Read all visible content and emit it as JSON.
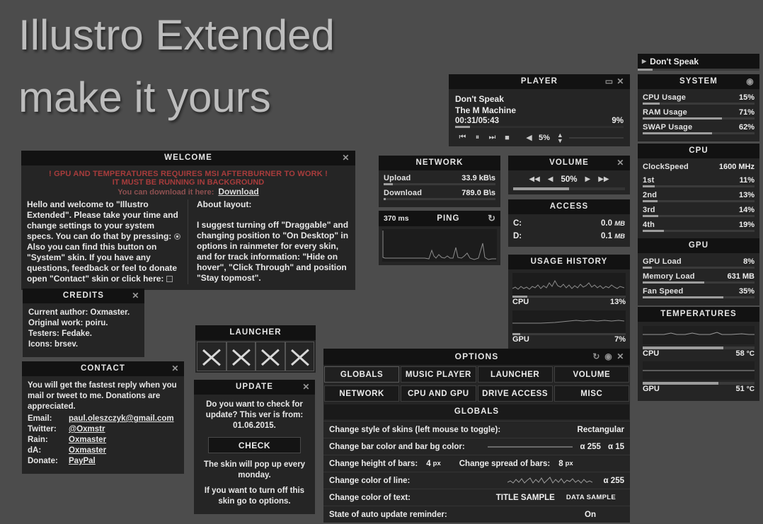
{
  "wallpaper": {
    "title": "Illustro Extended\nmake it yours"
  },
  "welcome": {
    "title": "WELCOME",
    "close": "✕",
    "warning_line1": "! GPU AND TEMPERATURES REQUIRES MSI AFTERBURNER TO WORK !",
    "warning_line2": "IT MUST BE RUNNING IN BACKGROUND",
    "download_prompt": "You can download it here:",
    "download_link": "Download",
    "left_text_1": "Hello and welcome to \"Illustro Extended\". Please take your time and change settings to your system specs. You can do that by pressing:",
    "left_text_2": "Also you can find this button on \"System\" skin. If you have any questions, feedback or feel to donate open \"Contact\" skin or click here:",
    "right_heading": "About layout:",
    "right_text": "I suggest turning off \"Draggable\" and changing position to \"On Desktop\" in options in rainmeter for every skin, and for track information: \"Hide on hover\", \"Click Through\" and position \"Stay topmost\"."
  },
  "credits": {
    "title": "CREDITS",
    "close": "✕",
    "lines": [
      "Current author: Oxmaster.",
      "Original work: poiru.",
      "Testers: Fedake.",
      "Icons: brsev."
    ]
  },
  "contact": {
    "title": "CONTACT",
    "close": "✕",
    "intro": "You will get the fastest reply when you mail or tweet to me. Donations are appreciated.",
    "rows": [
      {
        "label": "Email:",
        "value": "paul.oleszczyk@gmail.com"
      },
      {
        "label": "Twitter:",
        "value": "@Oxmstr"
      },
      {
        "label": "Rain:",
        "value": "Oxmaster"
      },
      {
        "label": "dA:",
        "value": "Oxmaster"
      },
      {
        "label": "Donate:",
        "value": "PayPal"
      }
    ]
  },
  "launcher": {
    "title": "LAUNCHER",
    "slots": [
      "x-icon",
      "x-icon",
      "x-icon",
      "x-icon"
    ]
  },
  "update": {
    "title": "UPDATE",
    "close": "✕",
    "prompt": "Do you want to check for update? This ver is from: 01.06.2015.",
    "check_label": "CHECK",
    "note1": "The skin will pop up every monday.",
    "note2": "If you want to turn off this skin go to options."
  },
  "player": {
    "title": "PLAYER",
    "maximize": "▭",
    "close": "✕",
    "track": "Don't Speak",
    "artist": "The M Machine",
    "time": "00:31/05:43",
    "progress_pct": "9%",
    "progress_value": 9,
    "controls": [
      "prev-icon",
      "pause-icon",
      "next-icon",
      "stop-icon"
    ],
    "volume_icon": "speaker-icon",
    "volume_pct": "5%",
    "volume_value": 5
  },
  "network": {
    "title": "NETWORK",
    "rows": [
      {
        "label": "Upload",
        "value": "33.9 kB\\s",
        "bar": 8
      },
      {
        "label": "Download",
        "value": "789.0 B\\s",
        "bar": 2
      }
    ]
  },
  "ping": {
    "ms": "370 ms",
    "title": "PING",
    "refresh": "refresh-icon"
  },
  "volume": {
    "title": "VOLUME",
    "close": "✕",
    "prev_track": "◀◀",
    "down": "◀",
    "level": "50%",
    "level_value": 50,
    "up": "▶",
    "next_track": "▶▶"
  },
  "access": {
    "title": "ACCESS",
    "rows": [
      {
        "label": "C:",
        "value": "0.0",
        "unit": "MB"
      },
      {
        "label": "D:",
        "value": "0.1",
        "unit": "MB"
      }
    ]
  },
  "usage_history": {
    "title": "USAGE HISTORY",
    "rows": [
      {
        "label": "CPU",
        "value": "13%",
        "bar": 13
      },
      {
        "label": "GPU",
        "value": "7%",
        "bar": 7
      }
    ]
  },
  "nowplaying": {
    "arrow": "play-arrow-icon",
    "text": "Don't Speak",
    "bar": 12
  },
  "system": {
    "title": "SYSTEM",
    "settings_icon": "gear-icon",
    "rows": [
      {
        "label": "CPU Usage",
        "value": "15%",
        "bar": 15
      },
      {
        "label": "RAM Usage",
        "value": "71%",
        "bar": 71
      },
      {
        "label": "SWAP Usage",
        "value": "62%",
        "bar": 62
      }
    ]
  },
  "cpu": {
    "title": "CPU",
    "clock_label": "ClockSpeed",
    "clock_value": "1600 MHz",
    "cores": [
      {
        "label": "1st",
        "value": "11%",
        "bar": 11
      },
      {
        "label": "2nd",
        "value": "13%",
        "bar": 13
      },
      {
        "label": "3rd",
        "value": "14%",
        "bar": 14
      },
      {
        "label": "4th",
        "value": "19%",
        "bar": 19
      }
    ]
  },
  "gpu": {
    "title": "GPU",
    "rows": [
      {
        "label": "GPU Load",
        "value": "8%",
        "bar": 8
      },
      {
        "label": "Memory Load",
        "value": "631 MB",
        "bar": 55
      },
      {
        "label": "Fan Speed",
        "value": "35%",
        "bar": 72
      }
    ]
  },
  "temperatures": {
    "title": "TEMPERATURES",
    "rows": [
      {
        "label": "CPU",
        "value": "58",
        "unit": "°C",
        "bar": 72
      },
      {
        "label": "GPU",
        "value": "51",
        "unit": "°C",
        "bar": 68
      }
    ]
  },
  "options": {
    "title": "OPTIONS",
    "refresh_icon": "refresh-icon",
    "settings_icon": "gear-icon",
    "close": "✕",
    "tabs": [
      {
        "label": "GLOBALS",
        "active": true
      },
      {
        "label": "MUSIC PLAYER",
        "active": false
      },
      {
        "label": "LAUNCHER",
        "active": false
      },
      {
        "label": "VOLUME",
        "active": false
      },
      {
        "label": "NETWORK",
        "active": false
      },
      {
        "label": "CPU AND GPU",
        "active": false
      },
      {
        "label": "DRIVE ACCESS",
        "active": false
      },
      {
        "label": "MISC",
        "active": false
      }
    ],
    "section_title": "GLOBALS",
    "rows": {
      "style": {
        "label": "Change style of skins (left mouse to toggle):",
        "value": "Rectangular"
      },
      "bar_color": {
        "label": "Change bar color and bar bg color:",
        "alpha1": "α 255",
        "alpha2": "α  15"
      },
      "bar_height": {
        "label": "Change height of bars:",
        "value": "4",
        "unit": "px"
      },
      "bar_spread": {
        "label": "Change spread of bars:",
        "value": "8",
        "unit": "px"
      },
      "line_color": {
        "label": "Change color of line:",
        "alpha": "α 255"
      },
      "text_color": {
        "label": "Change color of text:",
        "title_sample": "TITLE SAMPLE",
        "data_sample": "DATA SAMPLE"
      },
      "auto_update": {
        "label": "State of auto update reminder:",
        "value": "On"
      }
    }
  },
  "colors": {
    "desktop_bg": "#4c4c4c",
    "panel_bg": "#252525",
    "panel_header_bg": "#121212",
    "text": "#ececec",
    "warning_red": "#a83c3c",
    "bar_fill": "#9d9d9d"
  }
}
